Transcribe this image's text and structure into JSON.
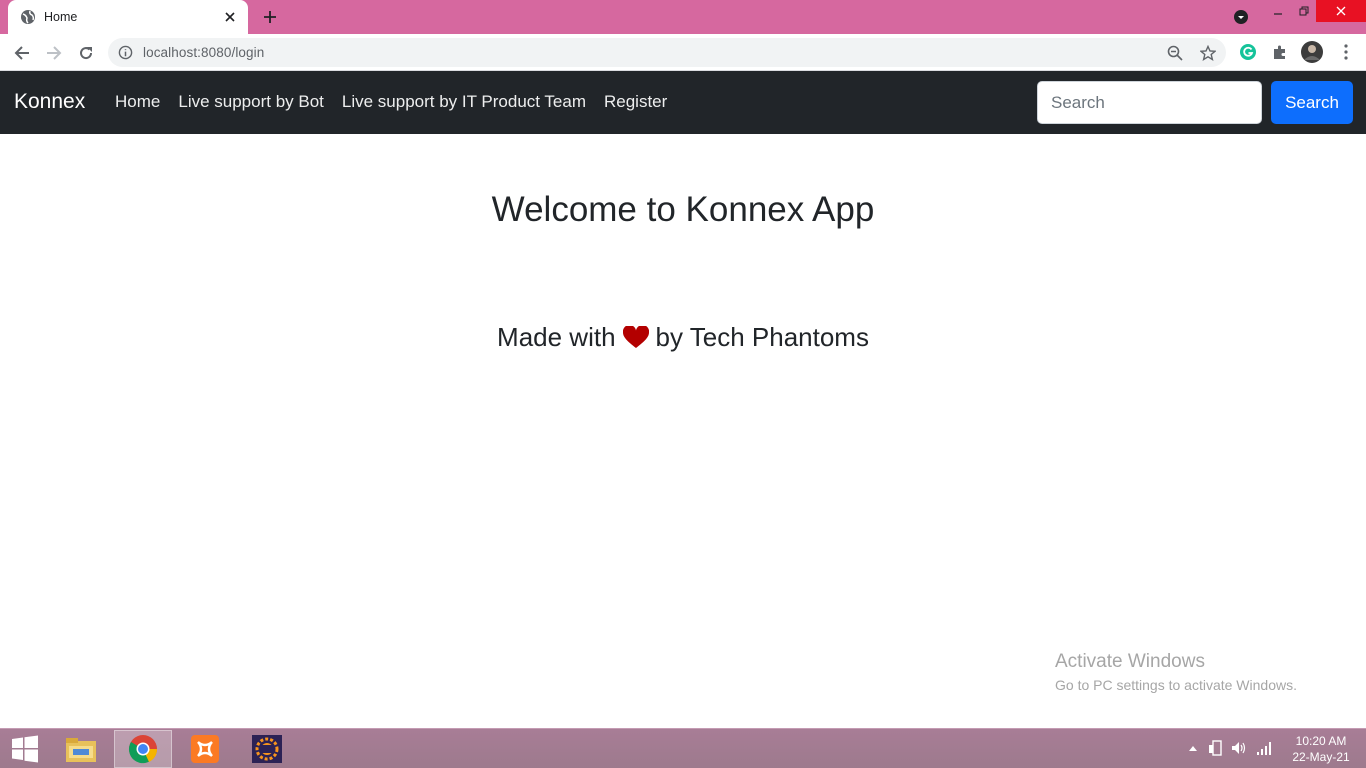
{
  "browser": {
    "tab_title": "Home",
    "url": "localhost:8080/login"
  },
  "navbar": {
    "brand": "Konnex",
    "links": [
      "Home",
      "Live support by Bot",
      "Live support by IT Product Team",
      "Register"
    ],
    "search_placeholder": "Search",
    "search_button": "Search"
  },
  "main": {
    "welcome": "Welcome to Konnex App",
    "made_with_prefix": "Made with",
    "made_with_suffix": "by Tech Phantoms"
  },
  "watermark": {
    "title": "Activate Windows",
    "subtitle": "Go to PC settings to activate Windows."
  },
  "taskbar": {
    "time": "10:20 AM",
    "date": "22-May-21"
  },
  "colors": {
    "tabstrip": "#d6689f",
    "navbar": "#212529",
    "primary": "#0d6efd",
    "heart": "#b30000"
  }
}
